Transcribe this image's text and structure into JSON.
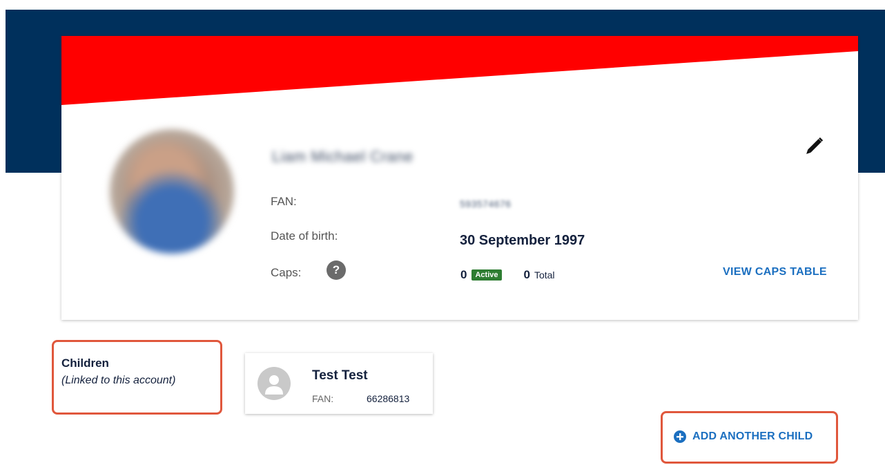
{
  "colors": {
    "navy": "#00305c",
    "banner_red": "#ff0000",
    "link_blue": "#1b6fc0",
    "active_green": "#2e7d32",
    "highlight_border": "#e0573c"
  },
  "profile": {
    "name": "Liam Michael Crane",
    "fan_label": "FAN:",
    "fan_value": "593574676",
    "dob_label": "Date of birth:",
    "dob_value": "30 September 1997",
    "caps_label": "Caps:",
    "caps_help_icon": "?",
    "active_count": "0",
    "active_badge": "Active",
    "total_count": "0",
    "total_label": "Total",
    "view_caps_label": "VIEW CAPS TABLE",
    "edit_icon": "pencil-icon"
  },
  "children": {
    "title": "Children",
    "subtitle": "(Linked to this account)",
    "items": [
      {
        "name": "Test Test",
        "fan_label": "FAN:",
        "fan_value": "66286813",
        "avatar_icon": "person-icon"
      }
    ],
    "add_label": "ADD ANOTHER CHILD",
    "add_icon": "plus-circle-icon"
  }
}
